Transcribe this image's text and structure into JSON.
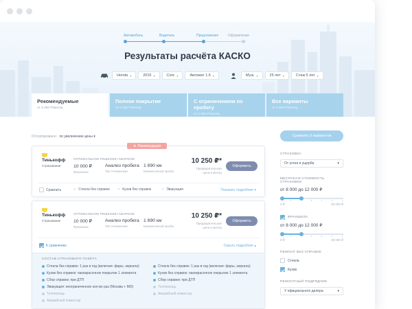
{
  "steps": [
    "Автомобиль",
    "Водитель",
    "Предложение",
    "Оформление"
  ],
  "page_title": "Результаты расчёта КАСКО",
  "car_params": [
    "Honda",
    "2015",
    "Civic",
    "Автомат 1.6"
  ],
  "driver_params": [
    "Муж.",
    "25 лет",
    "Стаж 5 лет"
  ],
  "tabs": [
    {
      "title": "Рекомендуемые",
      "sub": "от 6 250 Р/месяц"
    },
    {
      "title": "Полное покрытие",
      "sub": "от 6 250 Р/месяц"
    },
    {
      "title": "С ограничением по пробегу",
      "sub": "от 6 250 Р/месяц"
    },
    {
      "title": "Все варианты",
      "sub": "от 6 250 Р/месяц"
    }
  ],
  "sort": {
    "label": "Отсортировано:",
    "value": "по увеличению цены"
  },
  "cards": [
    {
      "badge": "Рекомендация",
      "insurer_line1": "Тинькофф",
      "insurer_line2": "Страхование",
      "note": "ОПТИМАЛЬНОЕ РЕШЕНИЕ+АВАРКОМ",
      "franchise_value": "10 000 ₽",
      "franchise_label": "Франшиза",
      "mileage_value": "Анализ пробега",
      "mileage_label": "Тип телематики",
      "distance_value": "1 890 км",
      "distance_label": "Ежемесячный пробег",
      "price": "10 250 ₽*",
      "price_note": "Предварительная цена в месяц",
      "order": "Оформить",
      "compare": "Сравнить",
      "features": [
        "Стекла без справок",
        "Кузов без справок",
        "Эвакуация"
      ],
      "more": "Показать подробнее"
    },
    {
      "insurer_line1": "Тинькофф",
      "insurer_line2": "Страхование",
      "note": "ОПТИМАЛЬНОЕ РЕШЕНИЕ+АВАРКОМ",
      "franchise_value": "10 000 ₽",
      "franchise_label": "Франшиза",
      "mileage_value": "Анализ пробега",
      "mileage_label": "Тип телематики",
      "distance_value": "1 890 км",
      "distance_label": "Ежемесячный пробег",
      "price": "10 250 ₽*",
      "price_note": "Предварительная цена в месяц",
      "order": "Оформить",
      "compare": "К сравнению",
      "more": "Скрыть подробнее",
      "details_head": "СОСТАВ СТРАХОВОГО ПАКЕТА",
      "details_left": [
        "Стекла без справок: 1 раз в год (включая: фары, зеркала)",
        "Кузов без справок: лакокрасочное покрытие 1 элемента",
        "Сбор справок: при ДТП",
        "Эвакуация: неограниченное кол-во раз (Москва + МО)"
      ],
      "details_left_dim": [
        "Техпомощь",
        "Аварийный комиссар"
      ],
      "details_right": [
        "Стекла без справок: 1 раз в год (включая: фары, зеркала)",
        "Кузов без справок: лакокрасочное покрытие 1 элемента",
        "Сбор справок: при ДТП"
      ],
      "details_right_dim": [
        "Техпомощь",
        "Аварийный комиссар"
      ]
    }
  ],
  "sidebar": {
    "compare_button": "Сравнить 5 вариантов",
    "insurance_label": "СТРАХОВКА",
    "insurance_value": "От угона и ущерба",
    "cost_label": "МЕСЯЧНАЯ СТОИМОСТЬ СТРАХОВКИ",
    "cost_range": "от 8 000 до 12 000 ₽",
    "cost_min": "0 ₽",
    "cost_max": "30 000 ₽",
    "franchise_check": "ФРАНШИЗА",
    "franchise_range": "от 8 000 до 12 000 ₽",
    "franchise_min": "0 ₽",
    "franchise_max": "30 000 ₽",
    "repair_label": "РЕМОНТ БЕЗ СПРАВОК",
    "repair_options": [
      "Стекла",
      "Кузов"
    ],
    "service_label": "РЕМОНТНЫЙ ПОДРЯДЧИК",
    "service_value": "У официального дилера"
  }
}
